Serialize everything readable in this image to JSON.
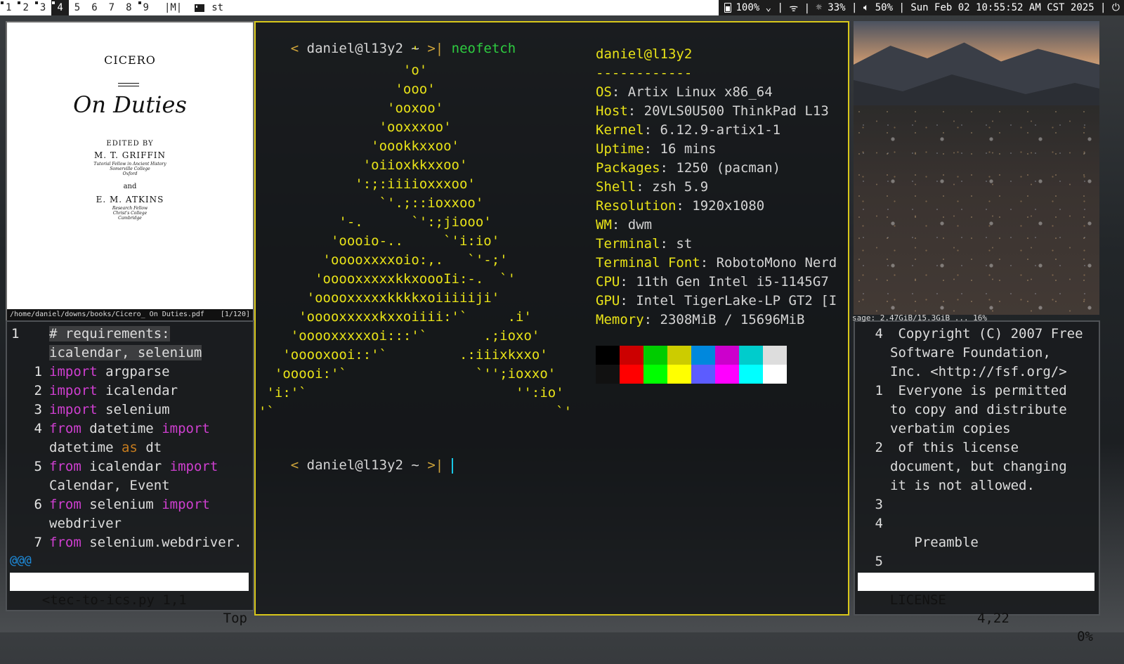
{
  "bar": {
    "tags": [
      {
        "label": "1",
        "occupied": true,
        "active": false
      },
      {
        "label": "2",
        "occupied": true,
        "active": false
      },
      {
        "label": "3",
        "occupied": true,
        "active": false
      },
      {
        "label": "4",
        "occupied": true,
        "active": true
      },
      {
        "label": "5",
        "occupied": false,
        "active": false
      },
      {
        "label": "6",
        "occupied": false,
        "active": false
      },
      {
        "label": "7",
        "occupied": false,
        "active": false
      },
      {
        "label": "8",
        "occupied": false,
        "active": false
      },
      {
        "label": "9",
        "occupied": true,
        "active": false
      }
    ],
    "layout": "|M|",
    "window_title": "st",
    "status": {
      "battery": "100%",
      "wifi_sep": "|",
      "brightness": "33%",
      "volume": "50%",
      "datetime": "Sun Feb 02 10:55:52 AM CST 2025"
    }
  },
  "pdf": {
    "author": "CICERO",
    "title": "On Duties",
    "edited_by": "EDITED BY",
    "editor1": "M. T. GRIFFIN",
    "editor1_note": [
      "Tutorial Fellow in Ancient History",
      "Somerville College",
      "Oxford"
    ],
    "and": "and",
    "editor2": "E. M. ATKINS",
    "editor2_note": [
      "Research Fellow",
      "Christ's College",
      "Cambridge"
    ],
    "path": "/home/daniel/downs/books/Cicero_ On Duties.pdf",
    "page": "[1/120]"
  },
  "vim": {
    "lines": [
      {
        "num": "1",
        "text": "# requirements:"
      },
      {
        "num": "",
        "text": "icalendar, selenium"
      },
      {
        "num": "1",
        "text": "import argparse"
      },
      {
        "num": "2",
        "text": "import icalendar"
      },
      {
        "num": "3",
        "text": "import selenium"
      },
      {
        "num": "4",
        "text": "from datetime import"
      },
      {
        "num": "",
        "text": "datetime as dt"
      },
      {
        "num": "5",
        "text": "from icalendar import"
      },
      {
        "num": "",
        "text": "Calendar, Event"
      },
      {
        "num": "6",
        "text": "from selenium import"
      },
      {
        "num": "",
        "text": "webdriver"
      },
      {
        "num": "7",
        "text": "from selenium.webdriver."
      }
    ],
    "at_line": "@@@",
    "status": {
      "file": "<tec-to-ics.py",
      "pos": "1,1",
      "scroll": "Top"
    }
  },
  "term": {
    "prompt_user": "daniel@l13y2",
    "prompt_dir": "~",
    "command": "neofetch",
    "ascii": "                   '\n                  'o'\n                 'ooo'\n                'ooxoo'\n               'ooxxxoo'\n              'oookkxxoo'\n             'oiioxkkxxoo'\n            ':;:iiiioxxxoo'\n               `'.;::ioxxoo'\n          '-.      `':;jiooo'\n         'oooio-..     `'i:io'\n        'ooooxxxxoio:,.   `'-;'\n       'ooooxxxxxkkxoooIi:-.  `'\n      'ooooxxxxxkkkkxoiiiiiji'\n     'ooooxxxxxkxxoiiii:'`     .i'\n    'ooooxxxxxoi:::'`       .;ioxo'\n   'ooooxooi::'`         .:iiixkxxo'\n  'ooooi:'`                `'';ioxxo'\n 'i:'`                          '':io'\n'`                                   `'",
    "info_title": "daniel@l13y2",
    "info_sep": "------------",
    "info": [
      {
        "k": "OS",
        "v": "Artix Linux x86_64"
      },
      {
        "k": "Host",
        "v": "20VLS0U500 ThinkPad L13"
      },
      {
        "k": "Kernel",
        "v": "6.12.9-artix1-1"
      },
      {
        "k": "Uptime",
        "v": "16 mins"
      },
      {
        "k": "Packages",
        "v": "1250 (pacman)"
      },
      {
        "k": "Shell",
        "v": "zsh 5.9"
      },
      {
        "k": "Resolution",
        "v": "1920x1080"
      },
      {
        "k": "WM",
        "v": "dwm"
      },
      {
        "k": "Terminal",
        "v": "st"
      },
      {
        "k": "Terminal Font",
        "v": "RobotoMono Nerd"
      },
      {
        "k": "CPU",
        "v": "11th Gen Intel i5-1145G7"
      },
      {
        "k": "GPU",
        "v": "Intel TigerLake-LP GT2 [I"
      },
      {
        "k": "Memory",
        "v": "2308MiB / 15696MiB"
      }
    ],
    "palette": [
      "#000000",
      "#cc0000",
      "#00cc00",
      "#cccc00",
      "#0088dd",
      "#cc00cc",
      "#00cccc",
      "#dddddd",
      "#111111",
      "#ff0000",
      "#00ff00",
      "#ffff00",
      "#5c5cff",
      "#ff00ff",
      "#00ffff",
      "#ffffff"
    ]
  },
  "less": {
    "partial_top": "sage: 2.47GiB/15.3GiB ... 16%",
    "lines": [
      {
        "num": "4",
        "text": " Copyright (C) 2007 Free"
      },
      {
        "num": "",
        "text": "Software Foundation,"
      },
      {
        "num": "",
        "text": "Inc. <http://fsf.org/>"
      },
      {
        "num": "1",
        "text": " Everyone is permitted"
      },
      {
        "num": "",
        "text": "to copy and distribute"
      },
      {
        "num": "",
        "text": "verbatim copies"
      },
      {
        "num": "2",
        "text": " of this license"
      },
      {
        "num": "",
        "text": "document, but changing"
      },
      {
        "num": "",
        "text": "it is not allowed."
      },
      {
        "num": "3",
        "text": ""
      },
      {
        "num": "4",
        "text": ""
      },
      {
        "num": "",
        "text": "   Preamble"
      },
      {
        "num": "5",
        "text": ""
      }
    ],
    "status": {
      "file": "LICENSE",
      "pos": "4,22",
      "scroll": "0%"
    }
  }
}
